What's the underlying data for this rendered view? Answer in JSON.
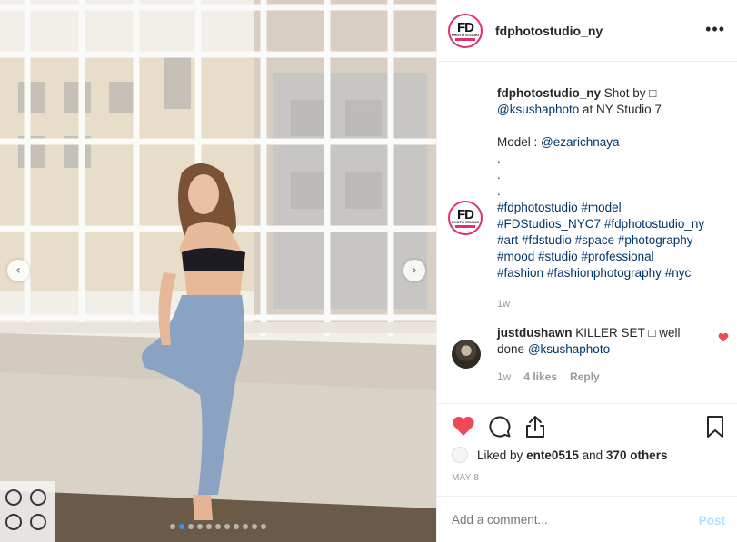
{
  "post": {
    "username": "fdphotostudio_ny",
    "avatar_text": "FD",
    "avatar_subtext": "PHOTO STUDIO",
    "more_label": "•••"
  },
  "caption": {
    "username": "fdphotostudio_ny",
    "text_1": "Shot by □",
    "mention_photographer": "@ksushaphoto",
    "text_2": "at NY Studio 7",
    "model_label": "Model :",
    "mention_model": "@ezarichnaya",
    "dot": ".",
    "hashtags": [
      "#fdphotostudio",
      "#model",
      "#FDStudios_NYC7",
      "#fdphotostudio_ny",
      "#art",
      "#fdstudio",
      "#space",
      "#photography",
      "#mood",
      "#studio",
      "#professional",
      "#fashion",
      "#fashionphotography",
      "#nyc"
    ],
    "time": "1w"
  },
  "comment": {
    "username": "justdushawn",
    "text": "KILLER SET □ well done",
    "mention": "@ksushaphoto",
    "time": "1w",
    "likes": "4 likes",
    "reply_label": "Reply"
  },
  "likes_summary": {
    "prefix": "Liked by",
    "user": "ente0515",
    "middle": "and",
    "others": "370 others"
  },
  "date": "MAY 8",
  "add_comment": {
    "placeholder": "Add a comment...",
    "post_label": "Post"
  },
  "carousel": {
    "prev_icon": "‹",
    "next_icon": "›",
    "slide_count": 11,
    "active_index": 1
  },
  "colors": {
    "like_red": "#ed4956",
    "link_blue": "#003569",
    "active_dot": "#3897f0",
    "post_disabled": "#b2dffc"
  }
}
